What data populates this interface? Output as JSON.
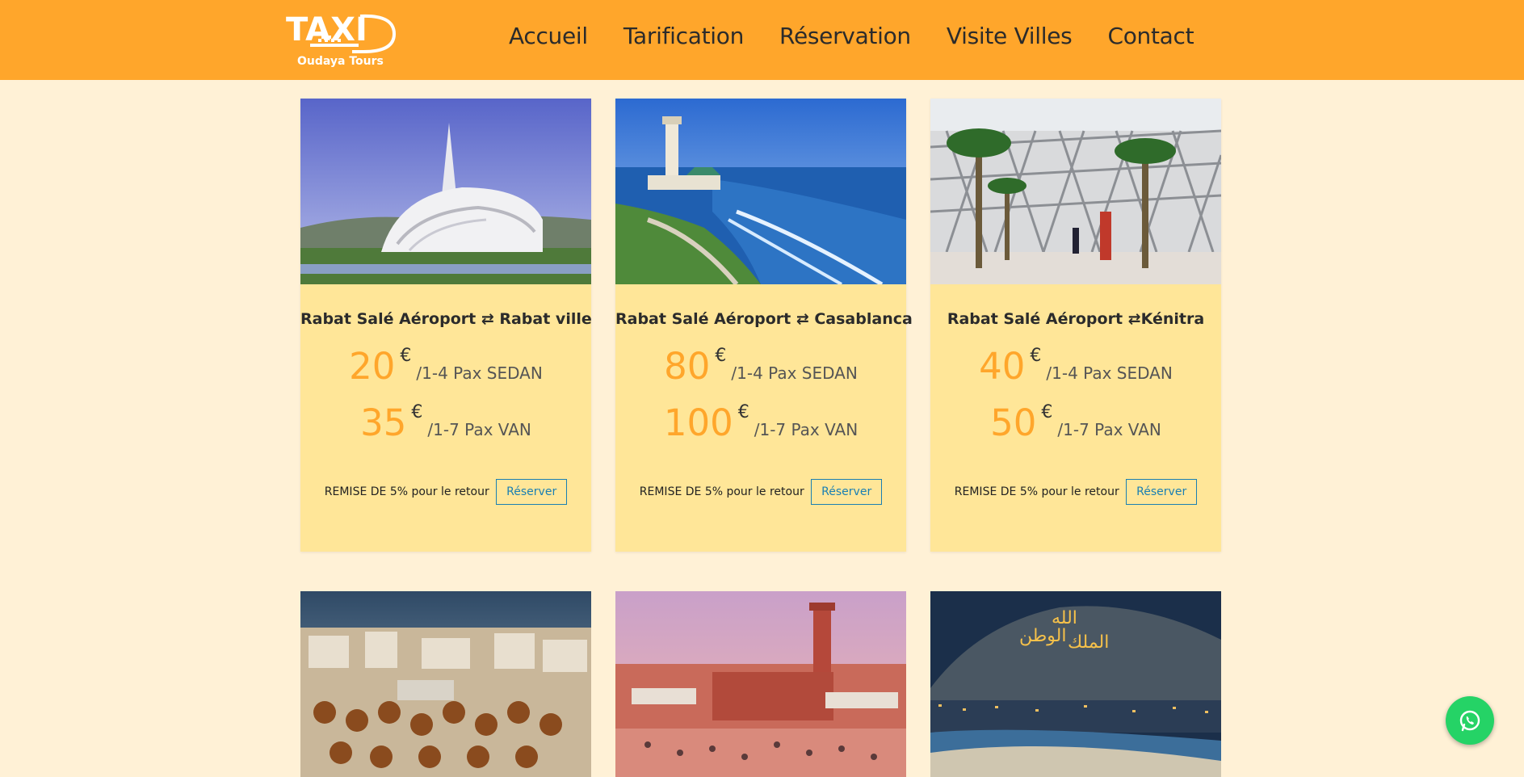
{
  "brand": {
    "logo_text": "TAXI",
    "sub": "Oudaya Tours"
  },
  "nav": [
    "Accueil",
    "Tarification",
    "Réservation",
    "Visite Villes",
    "Contact"
  ],
  "cards": [
    {
      "route": "Rabat Salé Aéroport ⇄ Rabat ville",
      "sedan_price": "20",
      "van_price": "35",
      "photo": "rabat-theatre-photo"
    },
    {
      "route": "Rabat Salé Aéroport ⇄ Casablanca",
      "sedan_price": "80",
      "van_price": "100",
      "photo": "casablanca-mosque-photo"
    },
    {
      "route": "Rabat Salé Aéroport ⇄Kénitra",
      "sedan_price": "40",
      "van_price": "50",
      "photo": "kenitra-station-photo"
    }
  ],
  "labels": {
    "currency": "€",
    "sedan_unit": "/1-4 Pax SEDAN",
    "van_unit": "/1-7 Pax VAN",
    "promo": "REMISE DE 5% pour le retour",
    "reserve_button": "Réserver"
  },
  "bottom_photos": [
    "fes-tanneries-photo",
    "marrakech-square-photo",
    "agadir-night-photo"
  ],
  "colors": {
    "header": "#ffa62b",
    "background": "#fff1d6",
    "card": "#ffe698",
    "price": "#ffa62b",
    "whatsapp": "#25d366"
  }
}
